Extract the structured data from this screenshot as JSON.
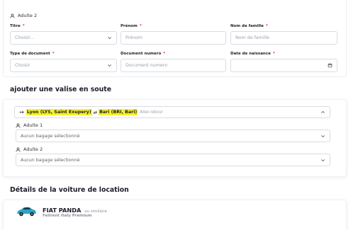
{
  "passenger": {
    "name": "Adulte 2",
    "fields_row1": {
      "title": {
        "label": "Titre",
        "value": "Choisir..."
      },
      "first_name": {
        "label": "Prénom",
        "placeholder": "Prénom"
      },
      "last_name": {
        "label": "Nom de famille",
        "placeholder": "Nom de famille"
      }
    },
    "fields_row2": {
      "doc_type": {
        "label": "Type de document",
        "value": "Choisir"
      },
      "doc_number": {
        "label": "Document numero",
        "placeholder": "Document numero"
      },
      "birth_date": {
        "label": "Date de naissance"
      }
    }
  },
  "luggage": {
    "title": "ajouter une valise en soute",
    "route": {
      "from": "Lyon (LYS, Saint Exupery)",
      "swap_icon": "⇄",
      "to": "Bari (BRI, Bari)",
      "trip_type": "Aller-retour"
    },
    "passengers": [
      {
        "name": "Adulte 1",
        "selection": "Aucun bagage sélectionné"
      },
      {
        "name": "Adulte 2",
        "selection": "Aucun bagage sélectionné"
      }
    ]
  },
  "rental": {
    "title": "Détails de la voiture de location",
    "car_model": "FIAT PANDA",
    "similar": "ou similaire",
    "provider": "Felirent Italy Premium",
    "car_color": "#2aa6c9"
  },
  "colors": {
    "required": "#e23b3b",
    "highlight": "#f7f32a"
  }
}
